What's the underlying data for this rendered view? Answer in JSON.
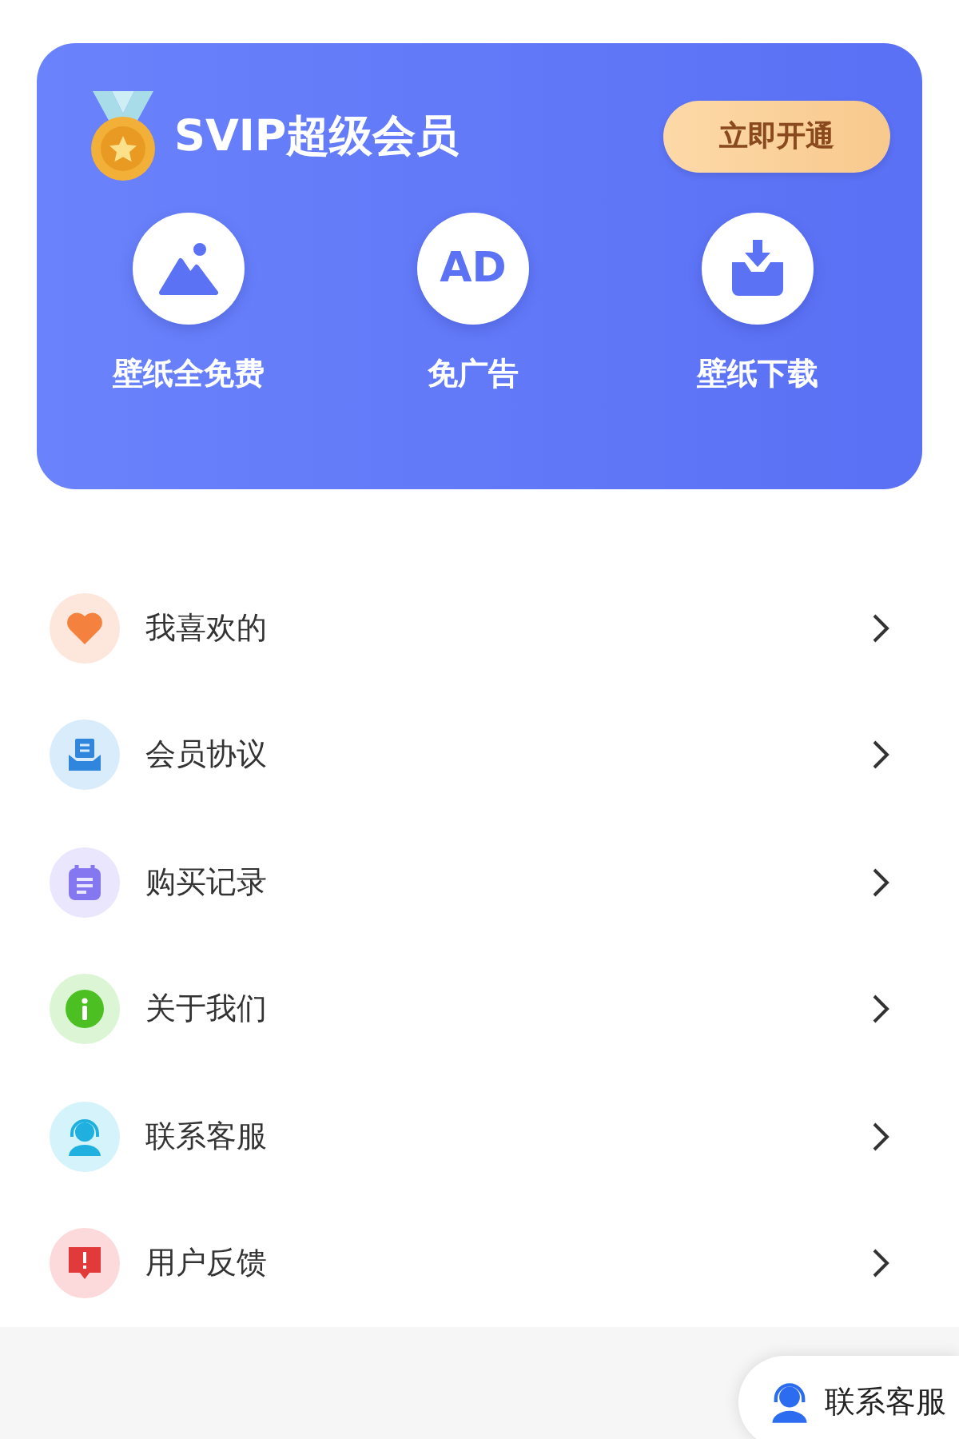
{
  "vip_card": {
    "title": "SVIP超级会员",
    "button": "立即开通",
    "features": [
      {
        "kind": "picture",
        "label": "壁纸全免费"
      },
      {
        "kind": "ad",
        "icon_text": "AD",
        "label": "免广告"
      },
      {
        "kind": "download",
        "label": "壁纸下载"
      }
    ]
  },
  "menu": [
    {
      "kind": "heart",
      "label": "我喜欢的"
    },
    {
      "kind": "doc",
      "label": "会员协议"
    },
    {
      "kind": "notes",
      "label": "购买记录"
    },
    {
      "kind": "info",
      "label": "关于我们"
    },
    {
      "kind": "service",
      "label": "联系客服"
    },
    {
      "kind": "alert",
      "label": "用户反馈"
    }
  ],
  "support_button": {
    "label": "联系客服"
  }
}
